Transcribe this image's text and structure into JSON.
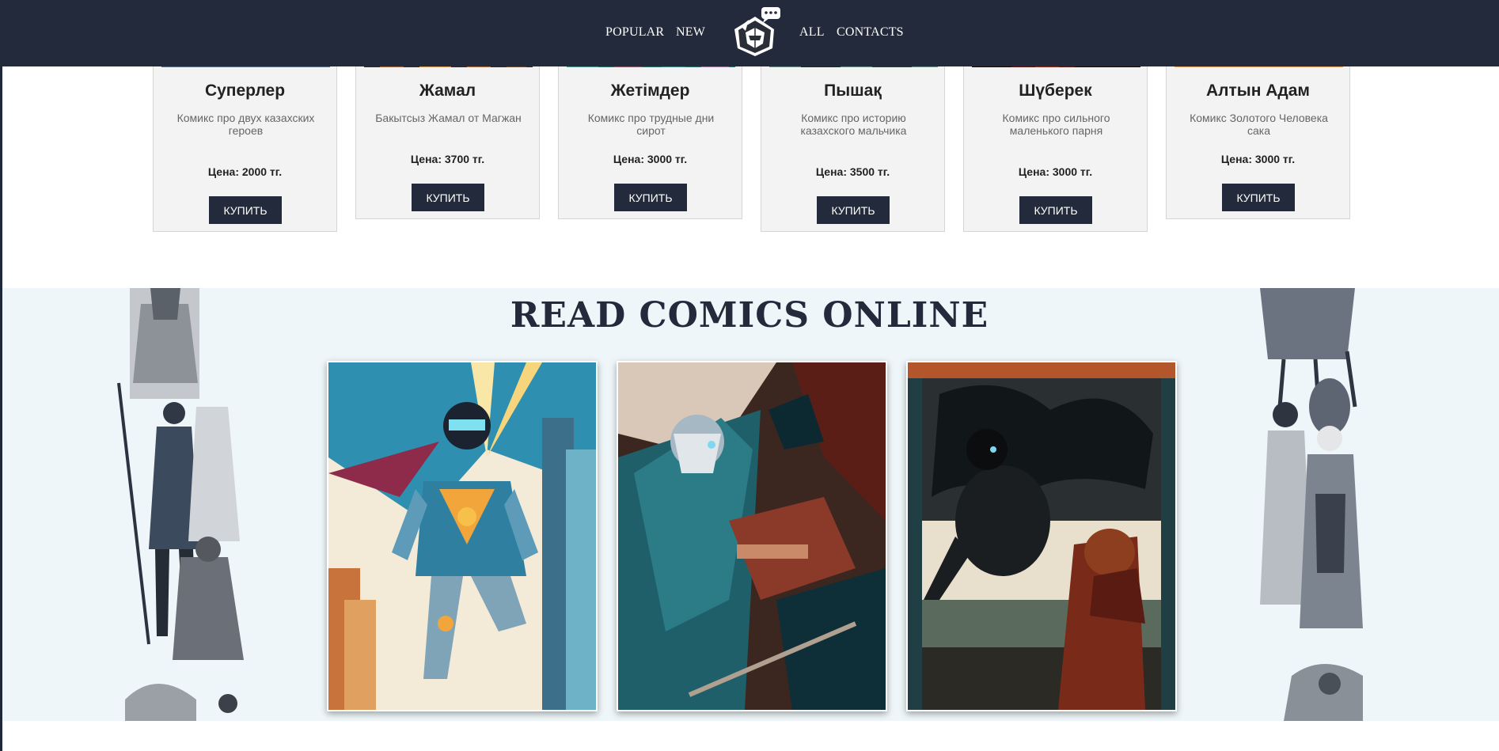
{
  "nav": {
    "items": [
      "POPULAR",
      "NEW",
      "ALL",
      "CONTACTS"
    ],
    "logo_icon": "hooded-figure-chat-logo"
  },
  "products": [
    {
      "title": "Суперлер",
      "description": "Комикс про двух казахских героев",
      "price": "Цена: 2000 тг.",
      "buy_label": "КУПИТЬ"
    },
    {
      "title": "Жамал",
      "description": "Бакытсыз Жамал от Магжан",
      "price": "Цена: 3700 тг.",
      "buy_label": "КУПИТЬ"
    },
    {
      "title": "Жетімдер",
      "description": "Комикс про трудные дни сирот",
      "price": "Цена: 3000 тг.",
      "buy_label": "КУПИТЬ"
    },
    {
      "title": "Пышақ",
      "description": "Комикс про историю казахского мальчика",
      "price": "Цена: 3500 тг.",
      "buy_label": "КУПИТЬ"
    },
    {
      "title": "Шүберек",
      "description": "Комикс про сильного маленького парня",
      "price": "Цена: 3000 тг.",
      "buy_label": "КУПИТЬ"
    },
    {
      "title": "Алтын Адам",
      "description": "Комикс Золотого Человека сака",
      "price": "Цена: 3000 тг.",
      "buy_label": "КУПИТЬ"
    }
  ],
  "read_online": {
    "title": "READ COMICS ONLINE",
    "comics": [
      {
        "cover": "superhero-city-cover"
      },
      {
        "cover": "old-warrior-battle-cover"
      },
      {
        "cover": "dark-creature-woman-cover"
      }
    ]
  },
  "colors": {
    "header_bg": "#222a3b",
    "card_bg": "#f3f3f3",
    "button_bg": "#222a3b",
    "section_bg": "#eef6f9"
  }
}
